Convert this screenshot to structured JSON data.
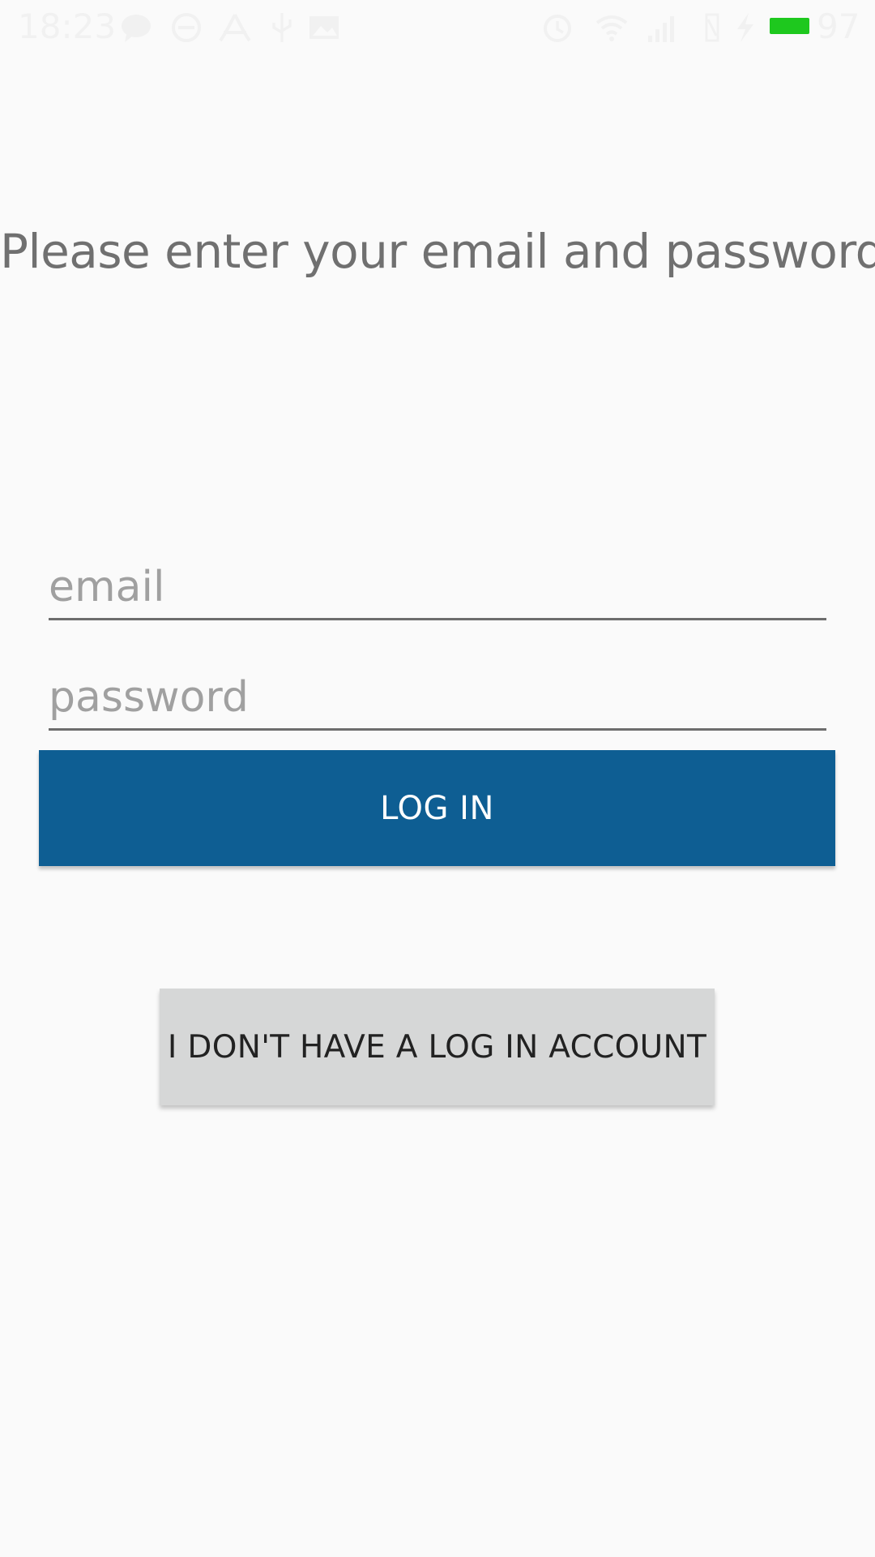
{
  "status_bar": {
    "time": "18:23",
    "battery_level": "97",
    "battery_color": "#1ec81e",
    "icons": [
      "chat-icon",
      "sync-icon",
      "pdf-icon",
      "usb-icon",
      "image-icon",
      "alarm-icon",
      "wifi-icon",
      "signal-icon",
      "no-sim-icon",
      "charging-icon"
    ]
  },
  "form": {
    "prompt": "Please enter your email and password:",
    "email_placeholder": "email",
    "password_placeholder": "password",
    "login_label": "LOG IN",
    "no_account_label": "I DON'T HAVE A LOG IN ACCOUNT"
  },
  "colors": {
    "primary": "#0e5e93",
    "background": "#fafafa",
    "secondary_button": "#d6d7d7"
  }
}
